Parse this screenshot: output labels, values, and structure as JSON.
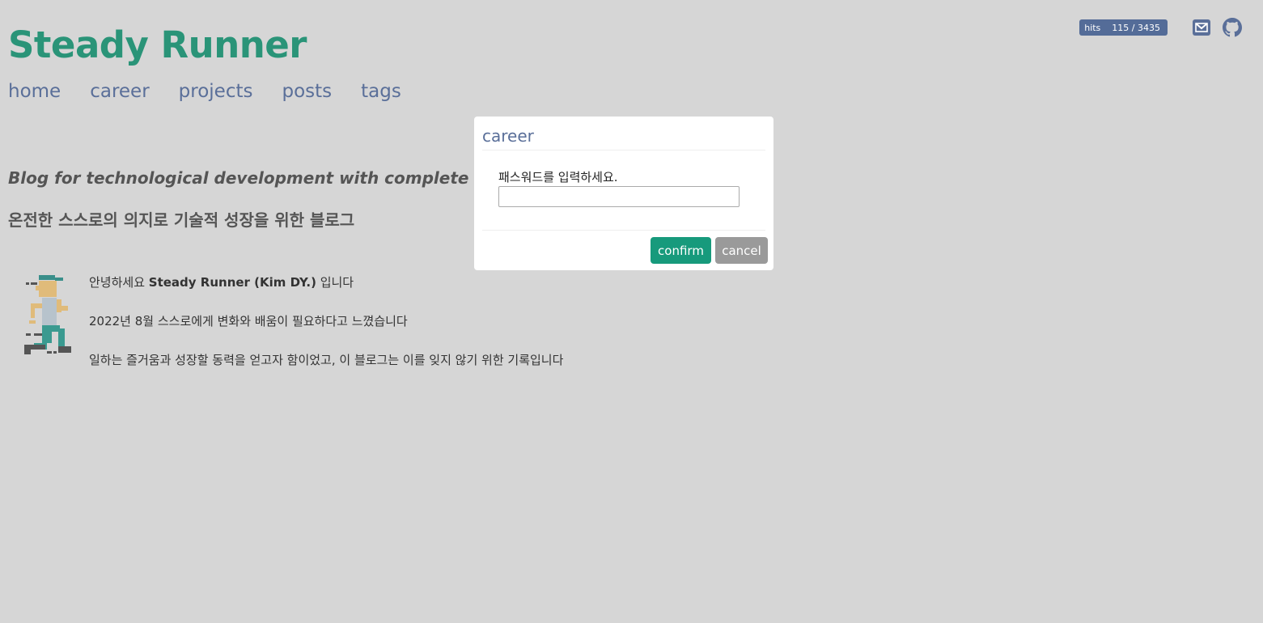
{
  "header": {
    "site_title": "Steady Runner",
    "nav": [
      {
        "label": "home"
      },
      {
        "label": "career"
      },
      {
        "label": "projects"
      },
      {
        "label": "posts"
      },
      {
        "label": "tags"
      }
    ],
    "hits": {
      "label": "hits",
      "value": "115 / 3435"
    },
    "icons": [
      "mail-icon",
      "github-icon"
    ]
  },
  "main": {
    "tagline_en": "Blog for technological development with complete self-will",
    "tagline_ko": "온전한 스스로의 의지로 기술적 성장을 위한 블로그",
    "intro": {
      "greeting_prefix": "안녕하세요 ",
      "greeting_name": "Steady Runner (Kim DY.)",
      "greeting_suffix": " 입니다",
      "line2": "2022년 8월 스스로에게 변화와 배움이 필요하다고 느꼈습니다",
      "line3": "일하는 즐거움과 성장할 동력을 얻고자 함이었고, 이 블로그는 이를 잊지 않기 위한 기록입니다"
    }
  },
  "modal": {
    "title": "career",
    "label": "패스워드를 입력하세요.",
    "input_value": "",
    "confirm_label": "confirm",
    "cancel_label": "cancel"
  },
  "colors": {
    "background": "#d6d6d6",
    "title": "#2a9478",
    "nav": "#5a6f99",
    "confirm": "#179a7c",
    "cancel": "#9a9a9a",
    "badge": "#546c98"
  }
}
